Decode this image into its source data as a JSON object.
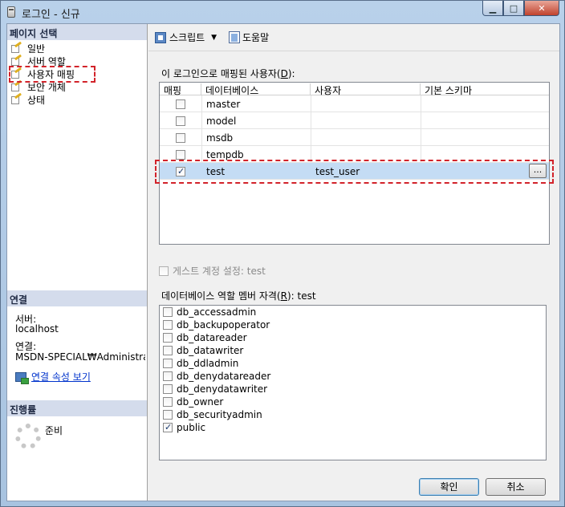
{
  "window": {
    "title": "로그인 - 신규"
  },
  "left": {
    "page_select_header": "페이지 선택",
    "nav_items": [
      "일반",
      "서버 역할",
      "사용자 매핑",
      "보안 개체",
      "상태"
    ],
    "connection_header": "연결",
    "server_label": "서버:",
    "server_value": "localhost",
    "connection_label": "연결:",
    "connection_value": "MSDN-SPECIAL₩Administra",
    "view_props_link": "연결 속성 보기",
    "progress_header": "진행률",
    "progress_status": "준비"
  },
  "toolbar": {
    "script_label": "스크립트",
    "help_label": "도움말"
  },
  "mapping": {
    "label_pre": "이 로그인으로 매핑된 사용자(",
    "label_key": "D",
    "label_post": "):",
    "columns": [
      "매핑",
      "데이터베이스",
      "사용자",
      "기본 스키마"
    ],
    "rows": [
      {
        "checked": false,
        "database": "master",
        "user": "",
        "schema": ""
      },
      {
        "checked": false,
        "database": "model",
        "user": "",
        "schema": ""
      },
      {
        "checked": false,
        "database": "msdb",
        "user": "",
        "schema": ""
      },
      {
        "checked": false,
        "database": "tempdb",
        "user": "",
        "schema": ""
      },
      {
        "checked": true,
        "database": "test",
        "user": "test_user",
        "schema": ""
      }
    ],
    "ellipsis": "..."
  },
  "guest": {
    "label": "게스트 계정 설정: test"
  },
  "roles": {
    "label_pre": "데이터베이스 역할 멤버 자격(",
    "label_key": "R",
    "label_post": "): test",
    "items": [
      {
        "name": "db_accessadmin",
        "checked": false
      },
      {
        "name": "db_backupoperator",
        "checked": false
      },
      {
        "name": "db_datareader",
        "checked": false
      },
      {
        "name": "db_datawriter",
        "checked": false
      },
      {
        "name": "db_ddladmin",
        "checked": false
      },
      {
        "name": "db_denydatareader",
        "checked": false
      },
      {
        "name": "db_denydatawriter",
        "checked": false
      },
      {
        "name": "db_owner",
        "checked": false
      },
      {
        "name": "db_securityadmin",
        "checked": false
      },
      {
        "name": "public",
        "checked": true
      }
    ]
  },
  "buttons": {
    "ok": "확인",
    "cancel": "취소"
  },
  "colors": {
    "selection": "#c4dcf4",
    "highlight_box": "#d2232a",
    "link": "#0033cc"
  }
}
